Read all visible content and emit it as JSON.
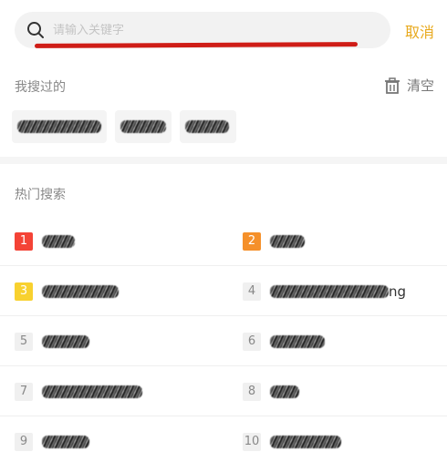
{
  "search": {
    "placeholder": "请输入关键字",
    "value": "",
    "cancel_label": "取消",
    "accent_color": "#e8a91d",
    "annotation_color": "#cf1d17"
  },
  "history": {
    "title": "我搜过的",
    "clear_label": "清空",
    "items": [
      "",
      "",
      ""
    ]
  },
  "hot": {
    "title": "热门搜索",
    "items": [
      {
        "rank": "1",
        "badge_bg": "#f44336",
        "badge_fg": "#ffffff",
        "text": ""
      },
      {
        "rank": "2",
        "badge_bg": "#f5902a",
        "badge_fg": "#ffffff",
        "text": ""
      },
      {
        "rank": "3",
        "badge_bg": "#f8d12f",
        "badge_fg": "#ffffff",
        "text": ""
      },
      {
        "rank": "4",
        "badge_bg": "#f0f0f0",
        "badge_fg": "#888888",
        "text": "ng"
      },
      {
        "rank": "5",
        "badge_bg": "#f0f0f0",
        "badge_fg": "#888888",
        "text": ""
      },
      {
        "rank": "6",
        "badge_bg": "#f0f0f0",
        "badge_fg": "#888888",
        "text": ""
      },
      {
        "rank": "7",
        "badge_bg": "#f0f0f0",
        "badge_fg": "#888888",
        "text": ""
      },
      {
        "rank": "8",
        "badge_bg": "#f0f0f0",
        "badge_fg": "#888888",
        "text": ""
      },
      {
        "rank": "9",
        "badge_bg": "#f0f0f0",
        "badge_fg": "#888888",
        "text": ""
      },
      {
        "rank": "10",
        "badge_bg": "#f0f0f0",
        "badge_fg": "#888888",
        "text": ""
      }
    ]
  }
}
